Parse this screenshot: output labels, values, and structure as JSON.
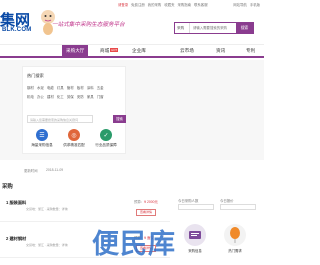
{
  "topbar": {
    "links": [
      "请登录",
      "免费注册",
      "我的采购",
      "收藏夹",
      "采购指南",
      "联系客服"
    ],
    "right": [
      "网站导航",
      "手机版"
    ]
  },
  "logo": {
    "big": "集网",
    "sub": "BLK.COM"
  },
  "slogan": "一站式集中采购生态服务平台",
  "search": {
    "select": "采购",
    "placeholder": "请输入需要搜索的采购",
    "button": "搜索"
  },
  "nav": {
    "items": [
      {
        "label": "采购大厅",
        "badge": ""
      },
      {
        "label": "商城",
        "badge": "HOT"
      },
      {
        "label": "企业库",
        "badge": ""
      },
      {
        "label": "云市场",
        "badge": ""
      },
      {
        "label": "资讯",
        "badge": ""
      },
      {
        "label": "专利",
        "badge": ""
      }
    ]
  },
  "hero": {
    "panel_title": "热门搜索",
    "keywords_row1": [
      "钢材",
      "水泥",
      "电缆",
      "灯具",
      "管材",
      "板材",
      "涂料",
      "五金"
    ],
    "keywords_row2": [
      "机电",
      "办公",
      "建材",
      "化工",
      "劳保",
      "安防",
      "家具",
      "门窗"
    ],
    "search_placeholder": "请输入您需要搜索的采购信息关键词",
    "search_button": "搜索",
    "features": [
      {
        "label": "海量采购信息",
        "icon": "list-icon",
        "color": "#2f6fd0"
      },
      {
        "label": "供求精准匹配",
        "icon": "target-icon",
        "color": "#e0663a"
      },
      {
        "label": "行业品质保障",
        "icon": "shield-icon",
        "color": "#2a9b6a"
      }
    ]
  },
  "strip": {
    "left": "更新时间",
    "mid": "2018-11-09"
  },
  "section": {
    "heading": "采购",
    "rows": [
      {
        "name": "1 服装面料",
        "meta": "交货地：浙江 · 采购数量：详询",
        "price_label": "预算：",
        "price": "¥ 2000元",
        "detail": "查看详情"
      },
      {
        "name": "2 建材钢材",
        "meta": "交货地：浙江 · 采购数量：详询",
        "price_label": "预算：",
        "price": "¥ 面议",
        "detail": "查看详情"
      }
    ]
  },
  "sidebox": {
    "left": "今日采购人数",
    "right": "今日报价"
  },
  "watermark": "便民库",
  "promo": [
    {
      "label": "采购信息",
      "icon": "document-icon",
      "bg": "#e9e3ef"
    },
    {
      "label": "热门需求",
      "icon": "balloon-icon",
      "bg": "#f3f3f3"
    }
  ]
}
